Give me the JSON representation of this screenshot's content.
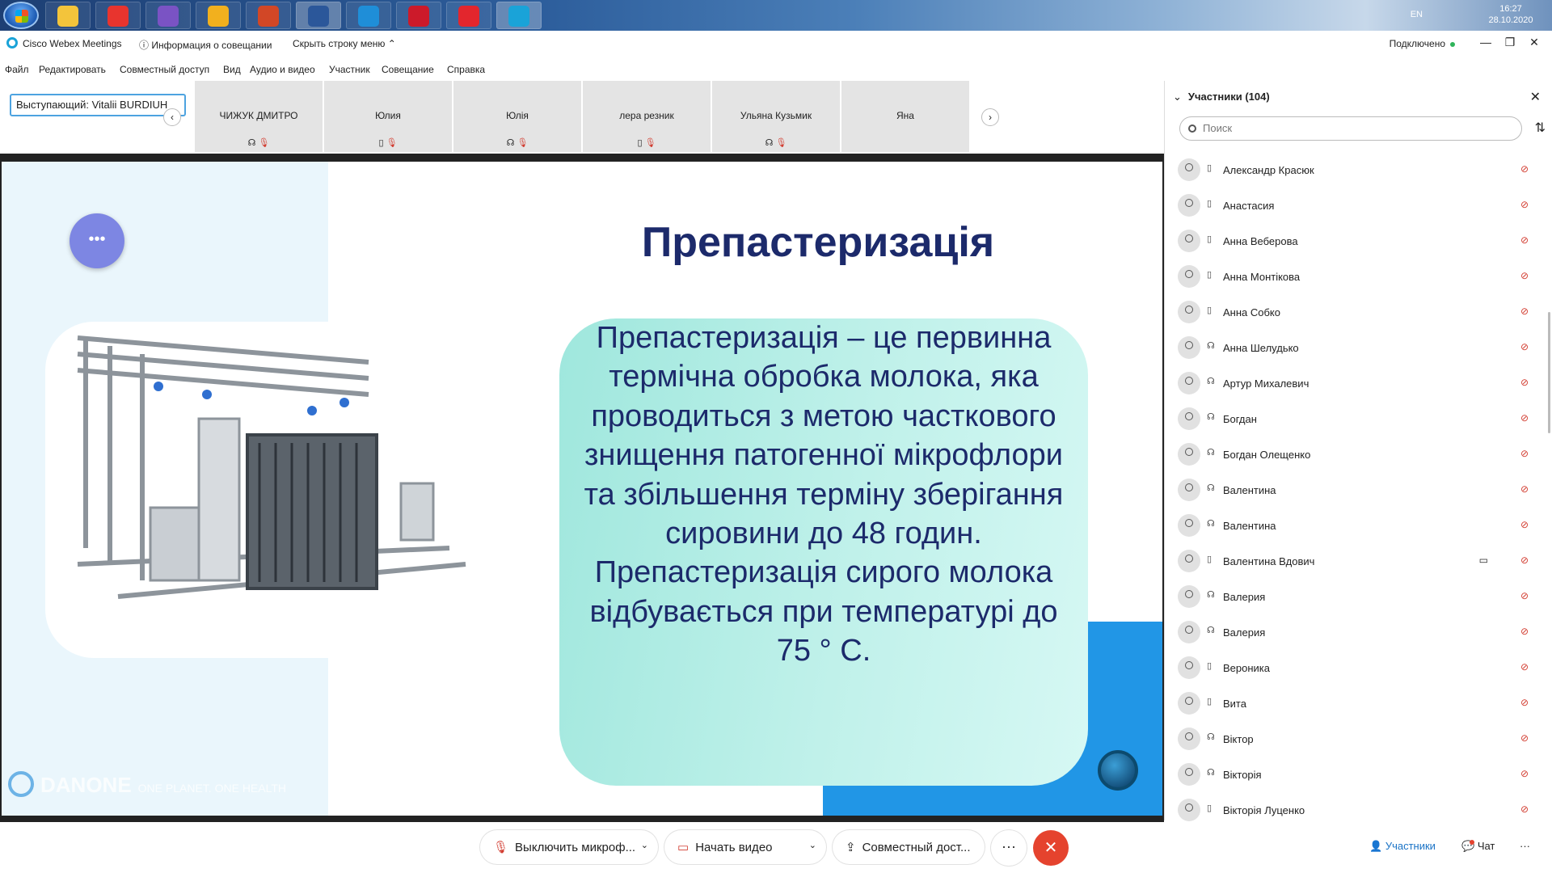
{
  "taskbar": {
    "lang": "EN",
    "time": "16:27",
    "date": "28.10.2020",
    "app_colors": [
      "#f3c43b",
      "#e8342e",
      "#7a53c4",
      "#f2b01e",
      "#d24726",
      "#2b579a",
      "#1f8ed8",
      "#cc1a2a",
      "#e3262d",
      "#1aa3d8"
    ]
  },
  "titlebar": {
    "app": "Cisco Webex Meetings",
    "info": "Информация о совещании",
    "hide": "Скрыть строку меню",
    "status": "Подключено",
    "minimize": "—",
    "restore": "❐",
    "close": "✕"
  },
  "menu": [
    "Файл",
    "Редактировать",
    "Совместный доступ",
    "Вид",
    "Аудио и видео",
    "Участник",
    "Совещание",
    "Справка"
  ],
  "strip": {
    "presenter": "Выступающий: Vitalii BURDIUH",
    "prev": "‹",
    "next": "›",
    "thumbs": [
      {
        "name": "ЧИЖУК ДМИТРО",
        "icon": "☊"
      },
      {
        "name": "Юлия",
        "icon": "▯"
      },
      {
        "name": "Юлія",
        "icon": "☊"
      },
      {
        "name": "лера резник",
        "icon": "▯"
      },
      {
        "name": "Ульяна Кузьмик",
        "icon": "☊"
      },
      {
        "name": "Яна",
        "icon": ""
      }
    ],
    "mute_glyph": "🎙"
  },
  "slide": {
    "title": "Препастеризація",
    "body": "Препастеризація – це первинна термічна обробка молока, яка проводиться з метою часткового знищення патогенної мікрофлори та збільшення терміну зберігання сировини до 48 годин. Препастеризація сирого молока відбувається при температурі до 75 ° С.",
    "brand": "DANONE",
    "tagline": "ONE PLANET. ONE HEALTH",
    "dots": "•••"
  },
  "participants": {
    "title": "Участники (104)",
    "chevron": "⌄",
    "close": "✕",
    "search_placeholder": "Поиск",
    "sort": "⇅",
    "mic_glyph": "⊘",
    "cam_glyph": "▭",
    "items": [
      {
        "name": "Александр Красюк",
        "dev": "▯"
      },
      {
        "name": "Анастасия",
        "dev": "▯"
      },
      {
        "name": "Анна Веберова",
        "dev": "▯"
      },
      {
        "name": "Анна Монтікова",
        "dev": "▯"
      },
      {
        "name": "Анна Собко",
        "dev": "▯"
      },
      {
        "name": "Анна Шелудько",
        "dev": "☊"
      },
      {
        "name": "Артур Михалевич",
        "dev": "☊"
      },
      {
        "name": "Богдан",
        "dev": "☊"
      },
      {
        "name": "Богдан Олещенко",
        "dev": "☊"
      },
      {
        "name": "Валентина",
        "dev": "☊"
      },
      {
        "name": "Валентина",
        "dev": "☊"
      },
      {
        "name": "Валентина Вдович",
        "dev": "▯",
        "cam": true
      },
      {
        "name": "Валерия",
        "dev": "☊"
      },
      {
        "name": "Валерия",
        "dev": "☊"
      },
      {
        "name": "Вероника",
        "dev": "▯"
      },
      {
        "name": "Вита",
        "dev": "▯"
      },
      {
        "name": "Віктор",
        "dev": "☊"
      },
      {
        "name": "Вікторія",
        "dev": "☊"
      },
      {
        "name": "Вікторія Луценко",
        "dev": "▯"
      }
    ]
  },
  "controls": {
    "mute": "Выключить микроф...",
    "video": "Начать видео",
    "share": "Совместный дост...",
    "more": "···",
    "end": "✕",
    "dropdown": "⌄",
    "participants_tab": "Участники",
    "chat_tab": "Чат",
    "panel_more": "···"
  }
}
